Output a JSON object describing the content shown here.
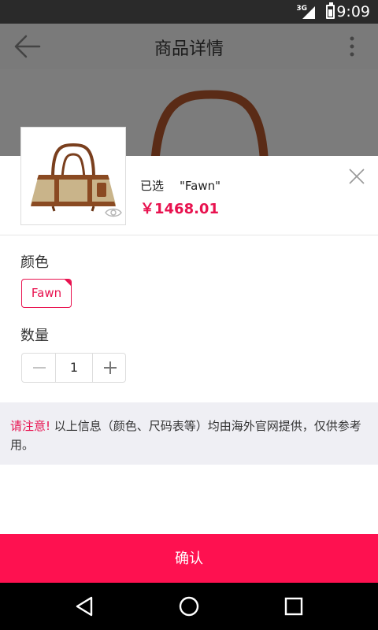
{
  "status_bar": {
    "network": "3G",
    "time": "9:09",
    "icons": [
      "signal-icon",
      "battery-charging-icon"
    ]
  },
  "app_bar": {
    "title": "商品详情",
    "icons": [
      "back-arrow-icon",
      "more-vertical-icon"
    ]
  },
  "sku_sheet": {
    "selected_label": "已选",
    "selected_value": "\"Fawn\"",
    "price": "￥1468.01",
    "icons": [
      "eye-icon",
      "close-icon"
    ],
    "color_label": "颜色",
    "color_options": [
      "Fawn"
    ],
    "quantity_label": "数量",
    "quantity": "1"
  },
  "notice": {
    "warning": "请注意!",
    "text": " 以上信息（颜色、尺码表等）均由海外官网提供，仅供参考用。"
  },
  "confirm_button": "确认",
  "nav_bar": {
    "icons": [
      "back-triangle-icon",
      "home-circle-icon",
      "recents-square-icon"
    ]
  },
  "colors": {
    "accent": "#fe1150",
    "status_bar": "#2a2a2a",
    "overlay": "#7a7a7a",
    "notice_bg": "#efeff4"
  }
}
